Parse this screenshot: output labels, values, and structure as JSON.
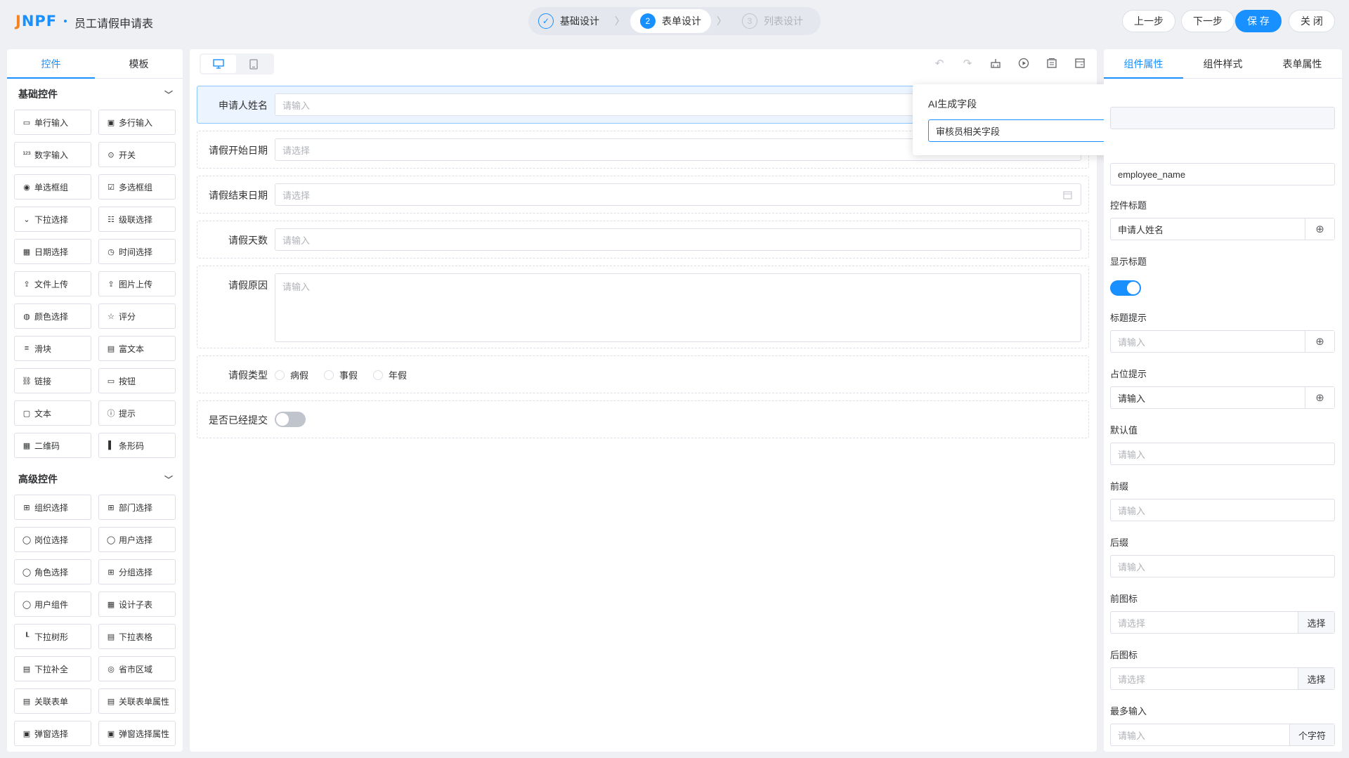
{
  "header": {
    "logo_a": "J",
    "logo_b": "NPF",
    "title": "员工请假申请表",
    "steps": [
      {
        "num": "✓",
        "label": "基础设计",
        "state": "done"
      },
      {
        "num": "2",
        "label": "表单设计",
        "state": "current"
      },
      {
        "num": "3",
        "label": "列表设计",
        "state": "wait"
      }
    ],
    "prev_label": "上一步",
    "next_label": "下一步",
    "save_label": "保 存",
    "close_label": "关 闭"
  },
  "left": {
    "tabs": [
      "控件",
      "模板"
    ],
    "basic_title": "基础控件",
    "basic": [
      {
        "icon": "▭",
        "label": "单行输入"
      },
      {
        "icon": "▣",
        "label": "多行输入"
      },
      {
        "icon": "¹²³",
        "label": "数字输入"
      },
      {
        "icon": "⊙",
        "label": "开关"
      },
      {
        "icon": "◉",
        "label": "单选框组"
      },
      {
        "icon": "☑",
        "label": "多选框组"
      },
      {
        "icon": "⌄",
        "label": "下拉选择"
      },
      {
        "icon": "☷",
        "label": "级联选择"
      },
      {
        "icon": "▦",
        "label": "日期选择"
      },
      {
        "icon": "◷",
        "label": "时间选择"
      },
      {
        "icon": "⇪",
        "label": "文件上传"
      },
      {
        "icon": "⇪",
        "label": "图片上传"
      },
      {
        "icon": "◍",
        "label": "颜色选择"
      },
      {
        "icon": "☆",
        "label": "评分"
      },
      {
        "icon": "≡",
        "label": "滑块"
      },
      {
        "icon": "▤",
        "label": "富文本"
      },
      {
        "icon": "⛓",
        "label": "链接"
      },
      {
        "icon": "▭",
        "label": "按钮"
      },
      {
        "icon": "▢",
        "label": "文本"
      },
      {
        "icon": "ⓘ",
        "label": "提示"
      },
      {
        "icon": "▦",
        "label": "二维码"
      },
      {
        "icon": "▌",
        "label": "条形码"
      }
    ],
    "advanced_title": "高级控件",
    "advanced": [
      {
        "icon": "⊞",
        "label": "组织选择"
      },
      {
        "icon": "⊞",
        "label": "部门选择"
      },
      {
        "icon": "◯",
        "label": "岗位选择"
      },
      {
        "icon": "◯",
        "label": "用户选择"
      },
      {
        "icon": "◯",
        "label": "角色选择"
      },
      {
        "icon": "⊞",
        "label": "分组选择"
      },
      {
        "icon": "◯",
        "label": "用户组件"
      },
      {
        "icon": "▦",
        "label": "设计子表"
      },
      {
        "icon": "┖",
        "label": "下拉树形"
      },
      {
        "icon": "▤",
        "label": "下拉表格"
      },
      {
        "icon": "▤",
        "label": "下拉补全"
      },
      {
        "icon": "◎",
        "label": "省市区域"
      },
      {
        "icon": "▤",
        "label": "关联表单"
      },
      {
        "icon": "▤",
        "label": "关联表单属性"
      },
      {
        "icon": "▣",
        "label": "弹窗选择"
      },
      {
        "icon": "▣",
        "label": "弹窗选择属性"
      }
    ]
  },
  "canvas": {
    "fields": [
      {
        "label": "申请人姓名",
        "placeholder": "请输入"
      },
      {
        "label": "请假开始日期",
        "placeholder": "请选择"
      },
      {
        "label": "请假结束日期",
        "placeholder": "请选择"
      },
      {
        "label": "请假天数",
        "placeholder": "请输入"
      },
      {
        "label": "请假原因",
        "placeholder": "请输入"
      },
      {
        "label": "请假类型",
        "options": [
          "病假",
          "事假",
          "年假"
        ]
      },
      {
        "label": "是否已经提交"
      }
    ]
  },
  "ai_popover": {
    "title": "AI生成字段",
    "value": "审核员相关字段"
  },
  "right": {
    "tabs": [
      "组件属性",
      "组件样式",
      "表单属性"
    ],
    "field_value": "employee_name",
    "title_label": "控件标题",
    "title_value": "申请人姓名",
    "show_title_label": "显示标题",
    "hint_label": "标题提示",
    "hint_placeholder": "请输入",
    "placeholder_label": "占位提示",
    "placeholder_value": "请输入",
    "default_label": "默认值",
    "default_placeholder": "请输入",
    "prefix_label": "前缀",
    "prefix_placeholder": "请输入",
    "suffix_label": "后缀",
    "suffix_placeholder": "请输入",
    "prefix_icon_label": "前图标",
    "prefix_icon_placeholder": "请选择",
    "suffix_icon_label": "后图标",
    "suffix_icon_placeholder": "请选择",
    "select_label": "选择",
    "max_label": "最多输入",
    "max_placeholder": "请输入",
    "max_unit": "个字符"
  },
  "colors": {
    "accent": "#1890ff",
    "logo_orange": "#f5821f"
  }
}
